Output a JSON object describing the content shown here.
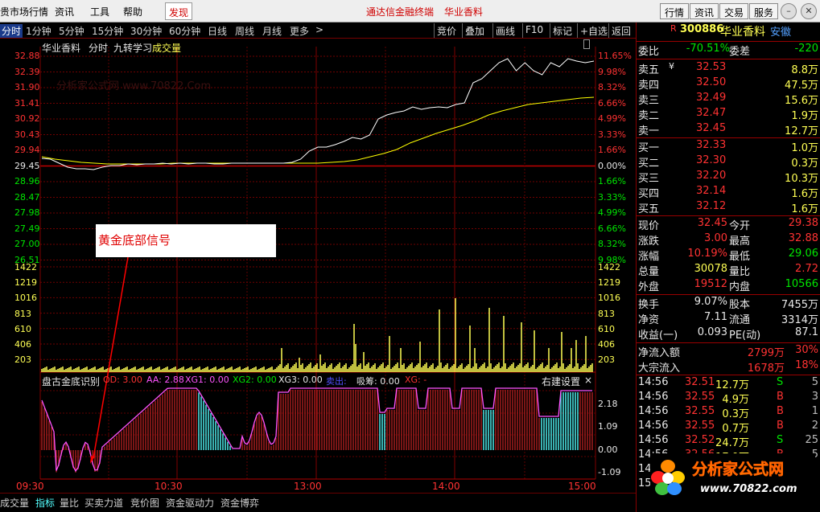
{
  "menubar": {
    "items": [
      "贵市场行情",
      "资讯",
      "工具",
      "帮助"
    ],
    "active": "发现",
    "links": [
      "通达信金融终端",
      "华业香料"
    ],
    "right_buttons": [
      "行情",
      "资讯",
      "交易",
      "服务"
    ]
  },
  "toolbar": {
    "timeframes": [
      "分时",
      "1分钟",
      "5分钟",
      "15分钟",
      "30分钟",
      "60分钟",
      "日线",
      "周线",
      "月线",
      "更多"
    ],
    "more_arrow": ">",
    "buttons": [
      "竞价",
      "叠加",
      "画线",
      "F10",
      "标记",
      "+自选",
      "返回"
    ]
  },
  "chart_header": {
    "stock": "华业香料",
    "mode": "分时",
    "formula": "九转学习",
    "volume_label": "成交量"
  },
  "price_axis": {
    "left": [
      "32.88",
      "32.39",
      "31.90",
      "31.41",
      "30.92",
      "30.43",
      "29.94",
      "29.45",
      "28.96",
      "28.47",
      "27.98",
      "27.49",
      "27.00",
      "26.51"
    ],
    "right": [
      "11.65%",
      "9.98%",
      "8.32%",
      "6.66%",
      "4.99%",
      "3.33%",
      "1.66%",
      "0.00%",
      "1.66%",
      "3.33%",
      "4.99%",
      "6.66%",
      "8.32%",
      "9.98%"
    ]
  },
  "volume_axis": {
    "ticks": [
      "1422",
      "1219",
      "1016",
      "813",
      "610",
      "406",
      "203"
    ]
  },
  "indicator": {
    "title": "盘古金底识别",
    "od": "OD: 3.00",
    "aa": "AA: 2.88",
    "xg1": "XG1: 0.00",
    "xg2": "XG2: 0.00",
    "xg3": "XG3: 0.00",
    "sell_tag": "卖出:",
    "chips": "吸筹: 0.00",
    "xg": "XG: -",
    "settings": "右建设置",
    "close": "×",
    "ticks": [
      "2.18",
      "1.09",
      "0.00",
      "-1.09"
    ]
  },
  "time_axis": [
    "09:30",
    "10:30",
    "13:00",
    "14:00",
    "15:00"
  ],
  "bottom_tabs": [
    "成交量",
    "指标",
    "量比",
    "买卖力道",
    "竞价图",
    "资金驱动力",
    "资金博弈"
  ],
  "callout": {
    "text": "黄金底部信号"
  },
  "watermark": "分析家公式网 www.70822.Com",
  "quote": {
    "code": "300886",
    "name": "华业香料",
    "region": "安徽",
    "r_tag": "R",
    "wei_bi_label": "委比",
    "wei_bi": "-70.51%",
    "wei_cha_label": "委差",
    "wei_cha": "-220",
    "asks": [
      {
        "label": "卖五",
        "price": "32.53",
        "vol": "8.8万",
        "mark": "¥"
      },
      {
        "label": "卖四",
        "price": "32.50",
        "vol": "47.5万",
        "mark": ""
      },
      {
        "label": "卖三",
        "price": "32.49",
        "vol": "15.6万",
        "mark": ""
      },
      {
        "label": "卖二",
        "price": "32.47",
        "vol": "1.9万",
        "mark": ""
      },
      {
        "label": "卖一",
        "price": "32.45",
        "vol": "12.7万",
        "mark": ""
      }
    ],
    "bids": [
      {
        "label": "买一",
        "price": "32.33",
        "vol": "1.0万"
      },
      {
        "label": "买二",
        "price": "32.30",
        "vol": "0.3万"
      },
      {
        "label": "买三",
        "price": "32.20",
        "vol": "10.3万"
      },
      {
        "label": "买四",
        "price": "32.14",
        "vol": "1.6万"
      },
      {
        "label": "买五",
        "price": "32.12",
        "vol": "1.6万"
      }
    ],
    "stats": [
      {
        "l1": "现价",
        "v1": "32.45",
        "l2": "今开",
        "v2": "29.38"
      },
      {
        "l1": "涨跌",
        "v1": "3.00",
        "l2": "最高",
        "v2": "32.88"
      },
      {
        "l1": "涨幅",
        "v1": "10.19%",
        "l2": "最低",
        "v2": "29.06"
      },
      {
        "l1": "总量",
        "v1": "30078",
        "l2": "量比",
        "v2": "2.72"
      },
      {
        "l1": "外盘",
        "v1": "19512",
        "l2": "内盘",
        "v2": "10566"
      }
    ],
    "stats2": [
      {
        "l1": "换手",
        "v1": "9.07%",
        "l2": "股本",
        "v2": "7455万"
      },
      {
        "l1": "净资",
        "v1": "7.11",
        "l2": "流通",
        "v2": "3314万"
      },
      {
        "l1": "收益(一)",
        "v1": "0.093",
        "l2": "PE(动)",
        "v2": "87.1"
      }
    ],
    "flows": [
      {
        "label": "净流入额",
        "value": "2799万",
        "pct": "30%"
      },
      {
        "label": "大宗流入",
        "value": "1678万",
        "pct": "18%"
      }
    ],
    "ticks": [
      {
        "time": "14:56",
        "price": "32.51",
        "vol": "12.7万",
        "side": "S",
        "n": "5"
      },
      {
        "time": "14:56",
        "price": "32.55",
        "vol": "4.9万",
        "side": "B",
        "n": "3"
      },
      {
        "time": "14:56",
        "price": "32.55",
        "vol": "0.3万",
        "side": "B",
        "n": "1"
      },
      {
        "time": "14:56",
        "price": "32.55",
        "vol": "0.7万",
        "side": "B",
        "n": "2"
      },
      {
        "time": "14:56",
        "price": "32.52",
        "vol": "24.7万",
        "side": "S",
        "n": "25"
      },
      {
        "time": "14:56",
        "price": "32.56",
        "vol": "17.9万",
        "side": "B",
        "n": "5"
      },
      {
        "time": "14:56",
        "price": "32.55",
        "vol": "",
        "side": "",
        "n": ""
      },
      {
        "time": "15:00",
        "price": "",
        "vol": "",
        "side": "",
        "n": ""
      }
    ]
  },
  "logo": {
    "text": "分析家公式网",
    "url": "www.70822.com"
  },
  "colors": {
    "up": "#ff3232",
    "down": "#00e600",
    "price_line": "#ffffff",
    "avg_line": "#ffff00",
    "volume": "#ffff54",
    "grid": "#800000"
  }
}
